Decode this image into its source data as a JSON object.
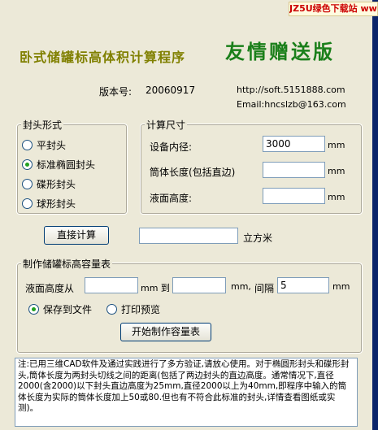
{
  "watermark": "JZ5U绿色下载站 www.jz5u.com",
  "header": {
    "title": "卧式储罐标高体积计算程序",
    "edition": "友情赠送版",
    "version_label": "版本号:",
    "version": "20060917",
    "url": "http://soft.5151888.com",
    "email": "Email:hncslzb@163.com"
  },
  "head_type": {
    "label": "封头形式",
    "options": [
      "平封头",
      "标准椭圆封头",
      "碟形封头",
      "球形封头"
    ],
    "selected": "标准椭圆封头"
  },
  "dimensions": {
    "label": "计算尺寸",
    "inner_diameter_label": "设备内径:",
    "inner_diameter": "3000",
    "cylinder_length_label": "筒体长度(包括直边)",
    "cylinder_length": "",
    "liquid_height_label": "液面高度:",
    "liquid_height": "",
    "unit": "mm"
  },
  "calc": {
    "button": "直接计算",
    "result": "",
    "result_unit": "立方米"
  },
  "table": {
    "label": "制作储罐标高容量表",
    "from_label": "液面高度从",
    "from_value": "",
    "from_unit": "mm 到",
    "to_value": "",
    "to_unit": "mm,",
    "step_label": "间隔",
    "step_value": "5",
    "step_unit": "mm",
    "output_options": [
      "保存到文件",
      "打印预览"
    ],
    "output_selected": "保存到文件",
    "button": "开始制作容量表"
  },
  "note": "注:已用三维CAD软件及通过实践进行了多方验证,请放心使用。对于椭圆形封头和碟形封头,筒体长度为两封头切线之间的距离(包括了两边封头的直边高度。通常情况下,直径2000(含2000)以下封头直边高度为25mm,直径2000以上为40mm,即程序中输入的筒体长度为实际的筒体长度加上50或80.但也有不符合此标准的封头,详情查看图纸或实测)。"
}
